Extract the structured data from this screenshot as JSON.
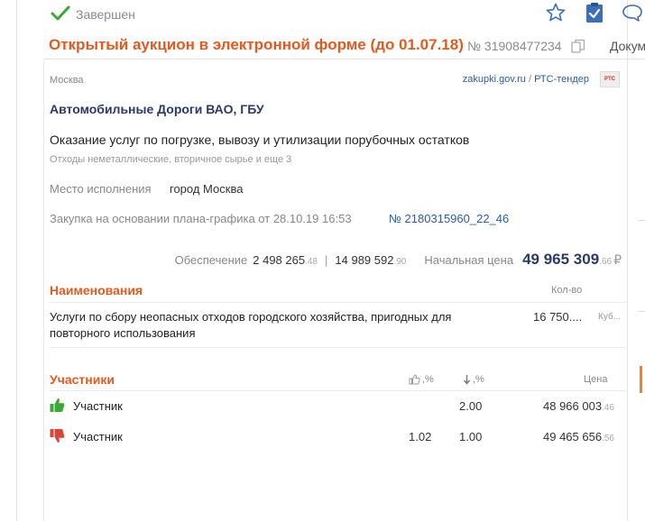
{
  "header": {
    "status": "Завершен",
    "title": "Открытый аукцион в электронной форме (до 01.07.18)",
    "number": "№ 31908477234",
    "documents_label": "Докум"
  },
  "icons": {
    "check": "check-icon",
    "star": "star-icon",
    "clipboard": "clipboard-check-icon",
    "chat": "chat-icon",
    "copy": "copy-icon",
    "like": "thumb-up-icon",
    "down": "arrow-down-icon",
    "win": "thumb-up-icon",
    "lose": "thumb-down-icon"
  },
  "colors": {
    "accent": "#e35a1f",
    "link": "#2a5ea8",
    "title_dark": "#2b3a6b",
    "win": "#3aa935",
    "lose": "#d9453b"
  },
  "card": {
    "city": "Москва",
    "source_site": "zakupki.gov.ru",
    "source_sep": " / ",
    "source_platform": "РТС-тендер",
    "platform_logo": "РТС",
    "customer": "Автомобильные Дороги ВАО, ГБУ",
    "subject": "Оказание услуг по погрузке, вывозу и утилизации порубочных остатков",
    "okpd": "Отходы неметаллические, вторичное сырье и еще 3",
    "place_label": "Место исполнения",
    "place_value": "город Москва",
    "plan_label": "Закупка на основании плана-графика от 28.10.19 16:53",
    "plan_number": "№ 2180315960_22_46"
  },
  "finance": {
    "security_label": "Обеспечение",
    "security_int": "2 498 265",
    "security_cents": ".48",
    "contract_security_int": "14 989 592",
    "contract_security_cents": ".90",
    "start_price_label": "Начальная цена",
    "start_price_int": "49 965 309",
    "start_price_cents": ".66",
    "currency": "₽"
  },
  "items": {
    "header": "Наименования",
    "qty_header": "Кол-во",
    "rows": [
      {
        "name": "Услуги по сбору неопасных отходов городского хозяйства, пригодных для повторного использования",
        "qty": "16 750....",
        "unit": "Куб..."
      }
    ]
  },
  "participants": {
    "header": "Участники",
    "col_like": ",%",
    "col_down": ",%",
    "col_price": "Цена",
    "rows": [
      {
        "name": "Участник",
        "result": "win",
        "like": "",
        "down": "2.00",
        "price_int": "48 966 003",
        "price_cents": ".46"
      },
      {
        "name": "Участник",
        "result": "lose",
        "like": "1.02",
        "down": "1.00",
        "price_int": "49 465 656",
        "price_cents": ".56"
      }
    ]
  }
}
